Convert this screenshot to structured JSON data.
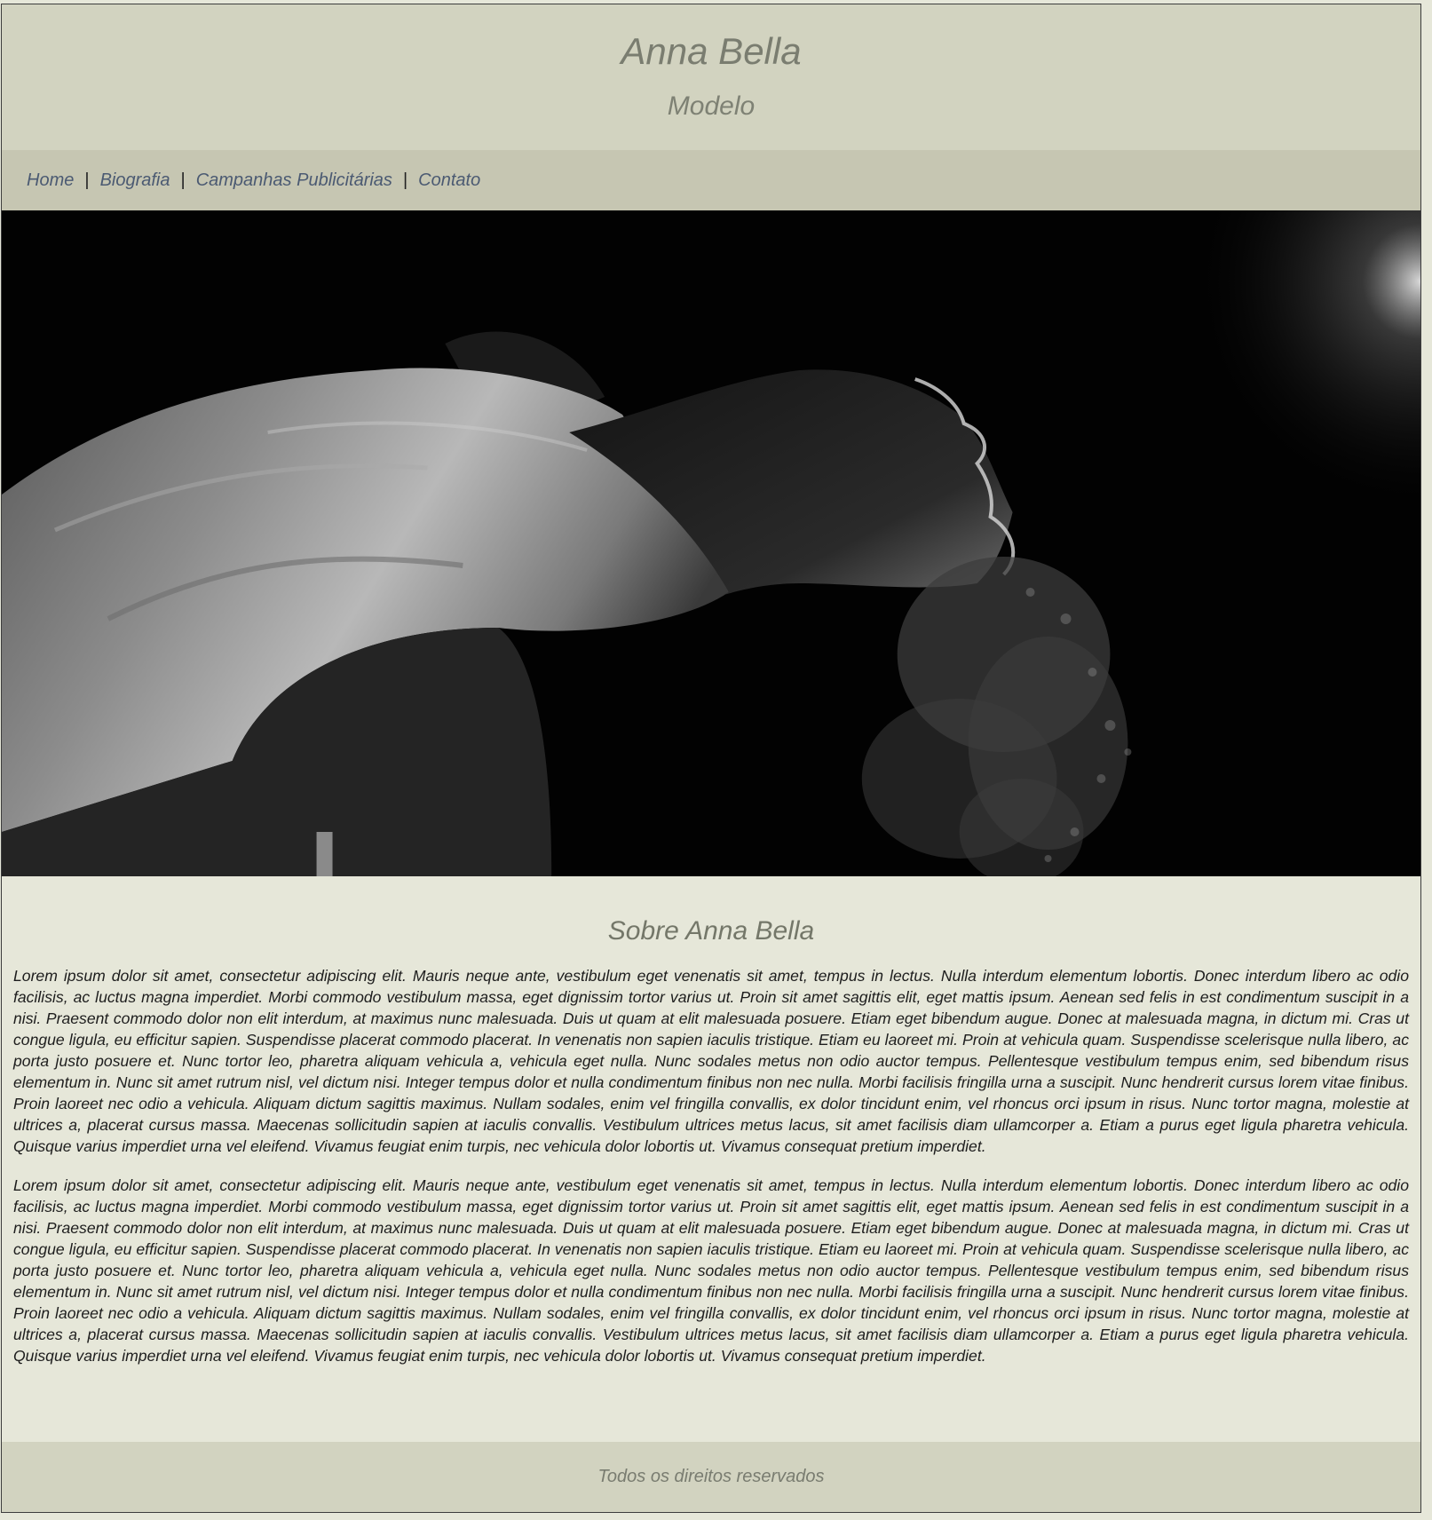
{
  "header": {
    "title": "Anna Bella",
    "subtitle": "Modelo"
  },
  "nav": {
    "items": [
      {
        "label": "Home"
      },
      {
        "label": "Biografia"
      },
      {
        "label": "Campanhas Publicitárias"
      },
      {
        "label": "Contato"
      }
    ],
    "separator": "|"
  },
  "hero": {
    "description_icon": "model-photo"
  },
  "about": {
    "title": "Sobre Anna Bella",
    "paragraphs": [
      "Lorem ipsum dolor sit amet, consectetur adipiscing elit. Mauris neque ante, vestibulum eget venenatis sit amet, tempus in lectus. Nulla interdum elementum lobortis. Donec interdum libero ac odio facilisis, ac luctus magna imperdiet. Morbi commodo vestibulum massa, eget dignissim tortor varius ut. Proin sit amet sagittis elit, eget mattis ipsum. Aenean sed felis in est condimentum suscipit in a nisi. Praesent commodo dolor non elit interdum, at maximus nunc malesuada. Duis ut quam at elit malesuada posuere. Etiam eget bibendum augue. Donec at malesuada magna, in dictum mi. Cras ut congue ligula, eu efficitur sapien. Suspendisse placerat commodo placerat. In venenatis non sapien iaculis tristique. Etiam eu laoreet mi. Proin at vehicula quam. Suspendisse scelerisque nulla libero, ac porta justo posuere et. Nunc tortor leo, pharetra aliquam vehicula a, vehicula eget nulla. Nunc sodales metus non odio auctor tempus. Pellentesque vestibulum tempus enim, sed bibendum risus elementum in. Nunc sit amet rutrum nisl, vel dictum nisi. Integer tempus dolor et nulla condimentum finibus non nec nulla. Morbi facilisis fringilla urna a suscipit. Nunc hendrerit cursus lorem vitae finibus. Proin laoreet nec odio a vehicula. Aliquam dictum sagittis maximus. Nullam sodales, enim vel fringilla convallis, ex dolor tincidunt enim, vel rhoncus orci ipsum in risus. Nunc tortor magna, molestie at ultrices a, placerat cursus massa. Maecenas sollicitudin sapien at iaculis convallis. Vestibulum ultrices metus lacus, sit amet facilisis diam ullamcorper a. Etiam a purus eget ligula pharetra vehicula. Quisque varius imperdiet urna vel eleifend. Vivamus feugiat enim turpis, nec vehicula dolor lobortis ut. Vivamus consequat pretium imperdiet.",
      "Lorem ipsum dolor sit amet, consectetur adipiscing elit. Mauris neque ante, vestibulum eget venenatis sit amet, tempus in lectus. Nulla interdum elementum lobortis. Donec interdum libero ac odio facilisis, ac luctus magna imperdiet. Morbi commodo vestibulum massa, eget dignissim tortor varius ut. Proin sit amet sagittis elit, eget mattis ipsum. Aenean sed felis in est condimentum suscipit in a nisi. Praesent commodo dolor non elit interdum, at maximus nunc malesuada. Duis ut quam at elit malesuada posuere. Etiam eget bibendum augue. Donec at malesuada magna, in dictum mi. Cras ut congue ligula, eu efficitur sapien. Suspendisse placerat commodo placerat. In venenatis non sapien iaculis tristique. Etiam eu laoreet mi. Proin at vehicula quam. Suspendisse scelerisque nulla libero, ac porta justo posuere et. Nunc tortor leo, pharetra aliquam vehicula a, vehicula eget nulla. Nunc sodales metus non odio auctor tempus. Pellentesque vestibulum tempus enim, sed bibendum risus elementum in. Nunc sit amet rutrum nisl, vel dictum nisi. Integer tempus dolor et nulla condimentum finibus non nec nulla. Morbi facilisis fringilla urna a suscipit. Nunc hendrerit cursus lorem vitae finibus. Proin laoreet nec odio a vehicula. Aliquam dictum sagittis maximus. Nullam sodales, enim vel fringilla convallis, ex dolor tincidunt enim, vel rhoncus orci ipsum in risus. Nunc tortor magna, molestie at ultrices a, placerat cursus massa. Maecenas sollicitudin sapien at iaculis convallis. Vestibulum ultrices metus lacus, sit amet facilisis diam ullamcorper a. Etiam a purus eget ligula pharetra vehicula. Quisque varius imperdiet urna vel eleifend. Vivamus feugiat enim turpis, nec vehicula dolor lobortis ut. Vivamus consequat pretium imperdiet."
    ]
  },
  "footer": {
    "text": "Todos os direitos reservados"
  },
  "colors": {
    "header_bg": "#d2d3c0",
    "nav_bg": "#c6c6b2",
    "page_bg": "#e6e7d9",
    "link": "#4b5a72",
    "title": "#7a7d70"
  }
}
